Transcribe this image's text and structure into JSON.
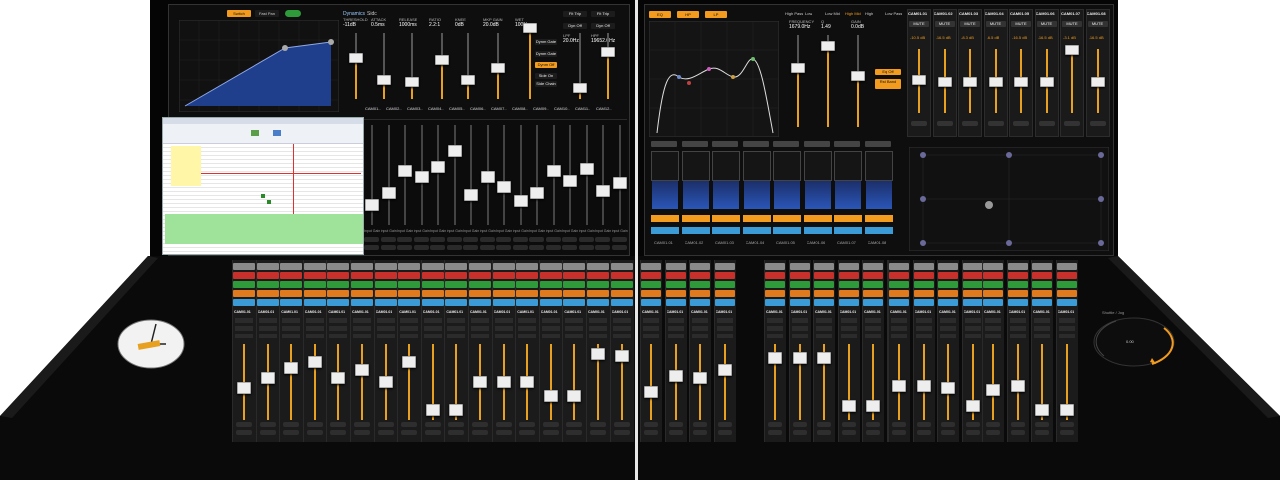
{
  "left_screen": {
    "top_buttons": [
      "Switch",
      "Fast Pan"
    ],
    "strip_title": "Dynamics",
    "strip_tab": "Sidc",
    "params": [
      {
        "label": "THRESHOLD",
        "value": "-11dB"
      },
      {
        "label": "ATTACK",
        "value": "0.5ms"
      },
      {
        "label": "RELEASE",
        "value": "1000ms"
      },
      {
        "label": "RATIO",
        "value": "2.2:1"
      },
      {
        "label": "KNEE",
        "value": "0dB"
      },
      {
        "label": "MKP GAIN",
        "value": "20.0dB"
      },
      {
        "label": "WET",
        "value": "100%"
      }
    ],
    "right_buttons": [
      "Fit Trip",
      "Fit Trip",
      "Dyn Off",
      "Dyn Off"
    ],
    "side_buttons": [
      "Dynm Gate",
      "Dynm Gate",
      "Dynm Off",
      "Side On",
      "Side Chain"
    ],
    "hp": {
      "label": "LPF",
      "value": "20.0Hz"
    },
    "lp": {
      "label": "HPF",
      "value": "19652.0Hz"
    },
    "bank_labels": [
      "CAM01..",
      "CAM02..",
      "CAM03..",
      "CAM04..",
      "CAM05..",
      "CAM06..",
      "CAM07..",
      "CAM08..",
      "CAM09..",
      "CAM10..",
      "CAM11..",
      "CAM12.."
    ],
    "fader_labels": [
      "Input Gain",
      "Input Gain",
      "Input Gain",
      "Input Gain",
      "Input Gain",
      "Input Gain",
      "Input Gain",
      "Input Gain",
      "Input Gain",
      "Input Gain",
      "Input Gain",
      "Input Gain",
      "Input Gain",
      "Input Gain",
      "Input Gain",
      "Input Gain"
    ]
  },
  "right_screen": {
    "eq_top_buttons": [
      "EQ",
      "HP",
      "LP"
    ],
    "eq_tabs": [
      "High Pass",
      "Low",
      "Low Mid",
      "High Mid",
      "High",
      "Low Pass"
    ],
    "eq_params": [
      {
        "label": "FREQUENCY",
        "value": "1679.0Hz"
      },
      {
        "label": "Q",
        "value": "1.49"
      },
      {
        "label": "GAIN",
        "value": "0.0dB"
      }
    ],
    "eq_side_buttons": [
      "Eq Off",
      "Rst Band"
    ],
    "meter_channels": [
      "CAM01.01",
      "CAM01.02",
      "CAM01.03",
      "CAM01.04",
      "CAM01.05",
      "CAM01.06",
      "CAM01.07",
      "CAM01.08"
    ],
    "top_channels": [
      {
        "name": "CAM01.01",
        "gain": "-10.5 dB"
      },
      {
        "name": "CAM01.02",
        "gain": "-16.5 dB"
      },
      {
        "name": "CAM01.03",
        "gain": "-8.3 dB"
      },
      {
        "name": "CAM01.04",
        "gain": "-6.5 dB"
      },
      {
        "name": "CAM01.05",
        "gain": "-16.5 dB"
      },
      {
        "name": "CAM01.06",
        "gain": "-16.5 dB"
      },
      {
        "name": "CAM01.07",
        "gain": "-3.1 dB"
      },
      {
        "name": "CAM01.08",
        "gain": "-16.5 dB"
      }
    ],
    "mute_label": "MUTE"
  },
  "console": {
    "left_strip_count": 17,
    "right_groups": [
      4,
      6,
      4,
      4
    ],
    "strip_rows": [
      "PAN",
      "SOLO",
      "SEL",
      "AUX",
      "CAM01.01",
      "CAMRA1",
      "Auto ID",
      "Input 1"
    ],
    "jog_label": "Shuttle / Jog",
    "jog_value": "0.00"
  },
  "colors": {
    "accent": "#f29b1e",
    "red": "#c8302c",
    "green": "#2e9a3a",
    "blue": "#3a9bd6",
    "plot": "#1f3f8c"
  }
}
